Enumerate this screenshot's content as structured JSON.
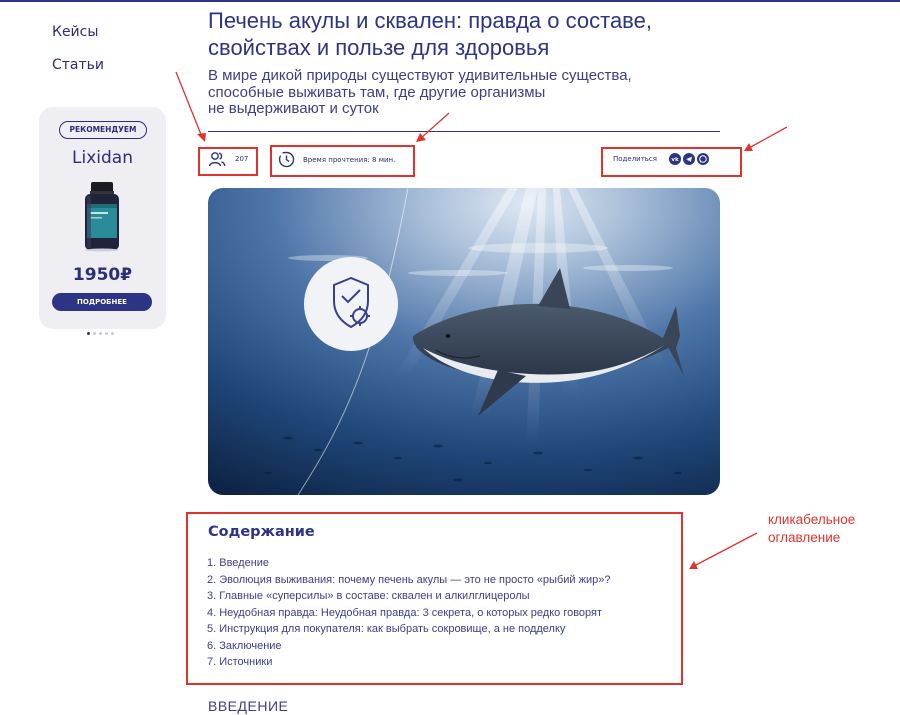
{
  "nav": {
    "items": [
      {
        "label": "Кейсы"
      },
      {
        "label": "Статьи"
      }
    ]
  },
  "promo": {
    "badge": "РЕКОМЕНДУЕМ",
    "product_name": "Lixidan",
    "price": "1950₽",
    "button_label": "ПОДРОБНЕЕ"
  },
  "article": {
    "title": "Печень акулы и сквален: правда о составе, свойствах и пользе для здоровья",
    "subtitle_lines": [
      "В мире дикой природы существуют удивительные существа,",
      "способные выживать там, где другие организмы",
      "не выдерживают и суток"
    ],
    "views": "207",
    "read_time": "Время прочтения: 8 мин.",
    "share_label": "Поделиться",
    "share_icons": [
      "vk-icon",
      "telegram-icon",
      "whatsapp-icon"
    ]
  },
  "toc": {
    "title": "Содержание",
    "items": [
      "1. Введение",
      "2. Эволюция выживания: почему печень акулы — это не просто «рыбий жир»?",
      "3. Главные «суперсилы» в составе: сквален и алкилглицеролы",
      "4. Неудобная правда: Неудобная правда: 3 секрета, о которых редко говорят",
      "5. Инструкция для покупателя: как выбрать сокровище, а не подделку",
      "6. Заключение",
      "7. Источники"
    ]
  },
  "section_heading": "ВВЕДЕНИЕ",
  "annotation": {
    "label": "кликабельное\nоглавление"
  },
  "colors": {
    "brand": "#2e3485",
    "annotation": "#e0332e",
    "card_bg": "#efeff3"
  }
}
